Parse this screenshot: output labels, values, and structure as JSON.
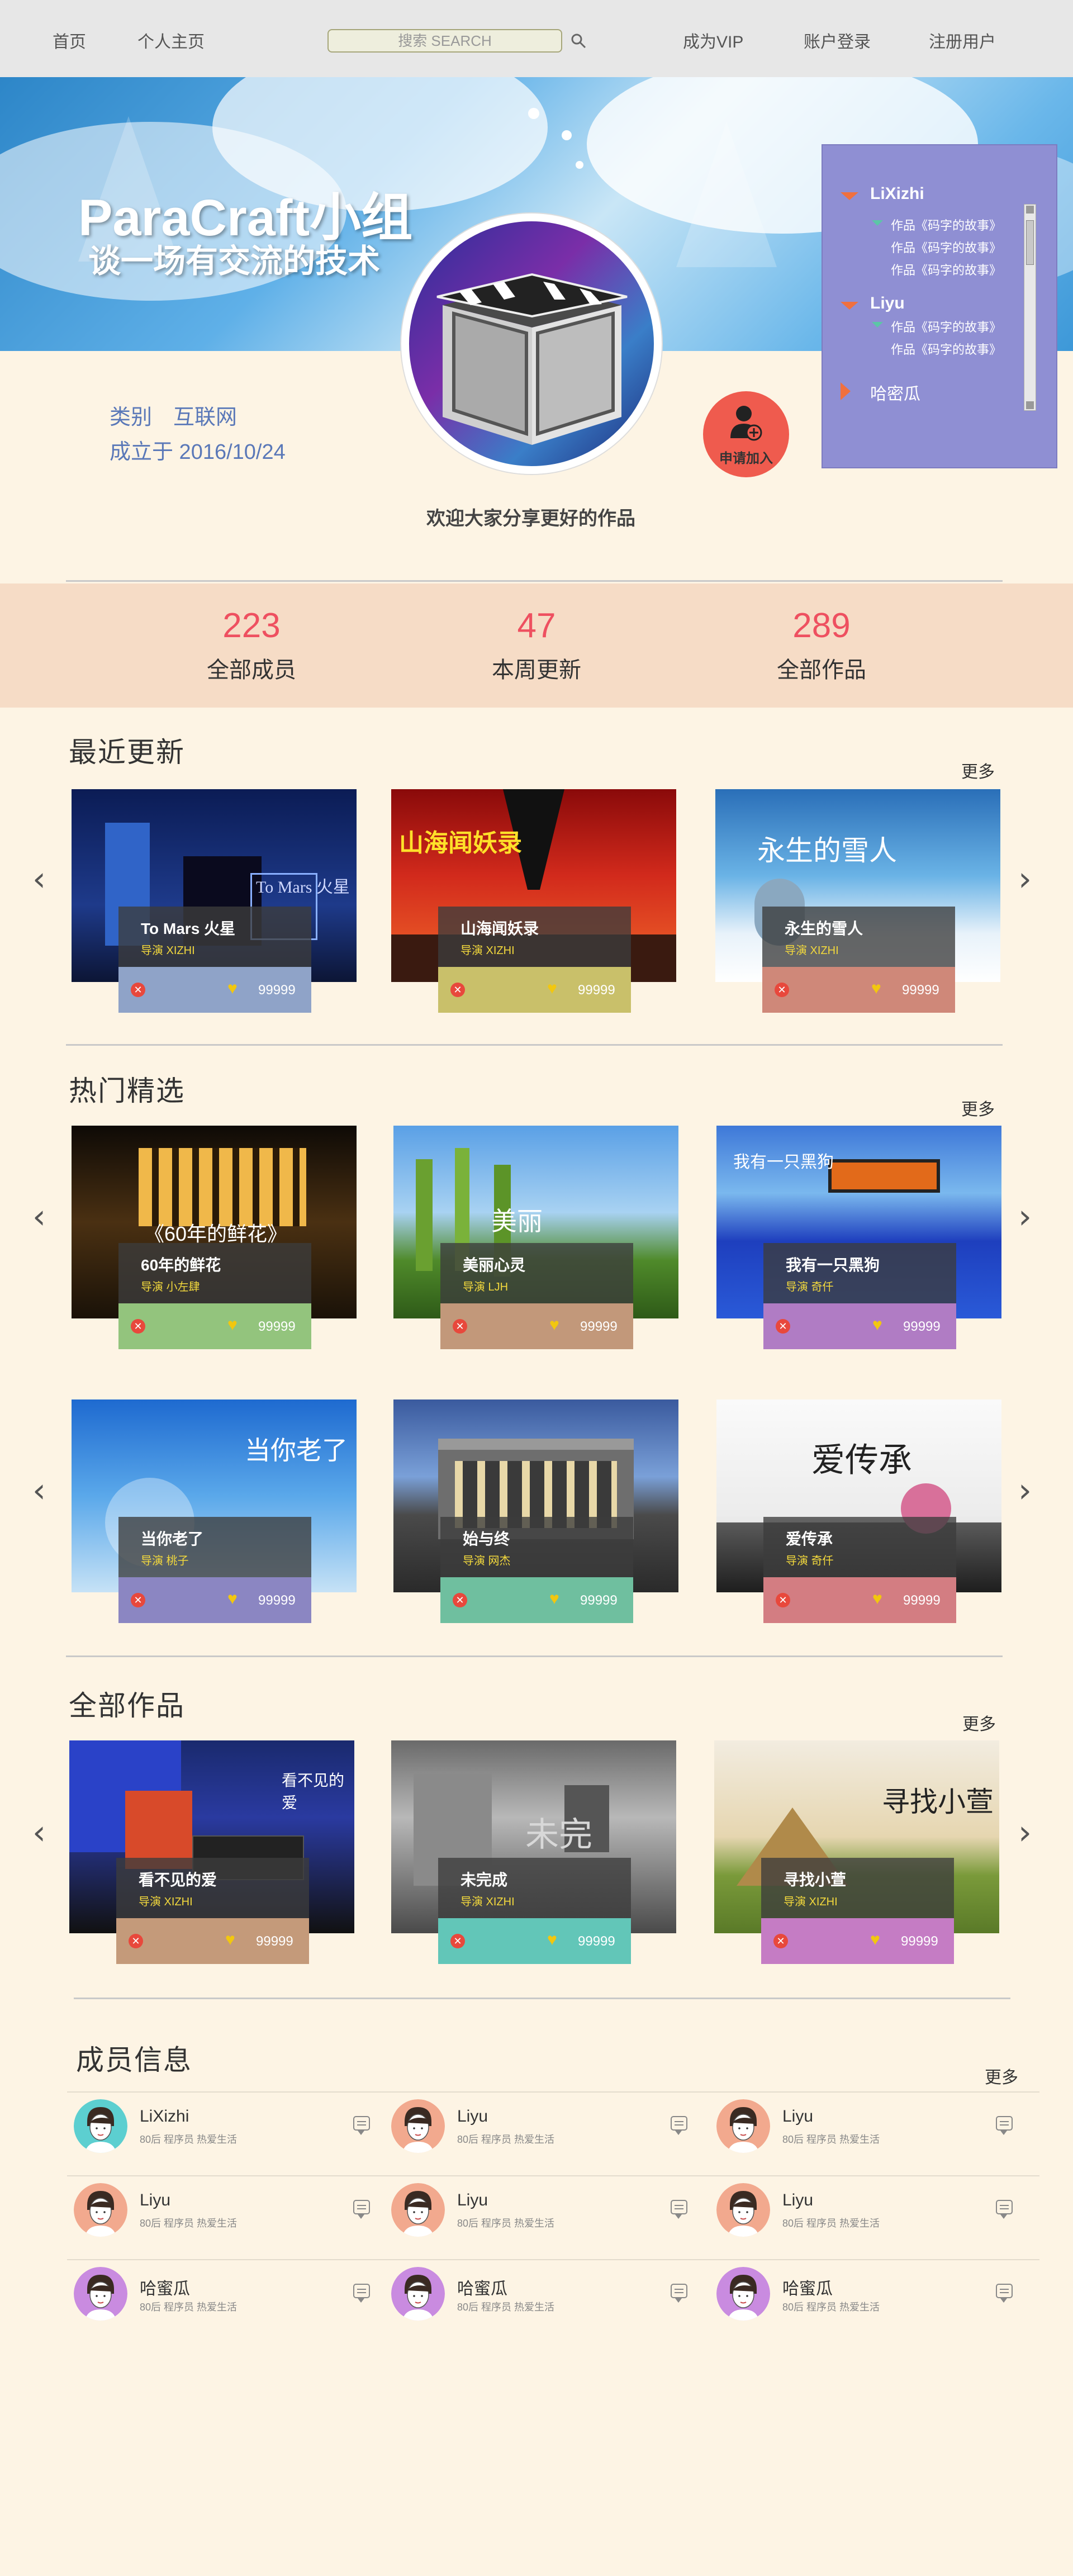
{
  "nav": {
    "home": "首页",
    "profile": "个人主页",
    "search_placeholder": "搜索 SEARCH",
    "vip": "成为VIP",
    "login": "账户登录",
    "register": "注册用户"
  },
  "hero": {
    "title": "ParaCraft小组",
    "subtitle": "谈一场有交流的技术",
    "category": "类别　互联网",
    "founded": "成立于 2016/10/24",
    "join_label": "申请加入",
    "welcome": "欢迎大家分享更好的作品"
  },
  "tree": {
    "users": [
      {
        "name": "LiXizhi",
        "works": [
          "作品《码字的故事》",
          "作品《码字的故事》",
          "作品《码字的故事》"
        ]
      },
      {
        "name": "Liyu",
        "works": [
          "作品《码字的故事》",
          "作品《码字的故事》"
        ]
      },
      {
        "name": "哈密瓜",
        "works": []
      }
    ]
  },
  "stats": [
    {
      "value": "223",
      "label": "全部成员"
    },
    {
      "value": "47",
      "label": "本周更新"
    },
    {
      "value": "289",
      "label": "全部作品"
    }
  ],
  "sections": {
    "recent": "最近更新",
    "hot": "热门精选",
    "all": "全部作品",
    "members": "成员信息",
    "more": "更多"
  },
  "recent_cards": [
    {
      "title": "To Mars 火星",
      "director": "导演 XIZHI",
      "likes": "99999",
      "bar_color": "#8fa3c8"
    },
    {
      "title": "山海闻妖录",
      "director": "导演 XIZHI",
      "likes": "99999",
      "bar_color": "#c9c06a"
    },
    {
      "title": "永生的雪人",
      "director": "导演 XIZHI",
      "likes": "99999",
      "bar_color": "#cf8879"
    }
  ],
  "hot_cards": [
    {
      "title": "60年的鲜花",
      "director": "导演 小左肆",
      "likes": "99999",
      "bar_color": "#93c47d"
    },
    {
      "title": "美丽心灵",
      "director": "导演 LJH",
      "likes": "99999",
      "bar_color": "#c2987a"
    },
    {
      "title": "我有一只黑狗",
      "director": "导演 奇仟",
      "likes": "99999",
      "bar_color": "#b07cc4"
    },
    {
      "title": "当你老了",
      "director": "导演 桃子",
      "likes": "99999",
      "bar_color": "#8b86c2"
    },
    {
      "title": "始与终",
      "director": "导演 网杰",
      "likes": "99999",
      "bar_color": "#6fbf9f"
    },
    {
      "title": "爱传承",
      "director": "导演 奇仟",
      "likes": "99999",
      "bar_color": "#d37d82"
    }
  ],
  "all_cards": [
    {
      "title": "看不见的爱",
      "director": "导演 XIZHI",
      "likes": "99999",
      "bar_color": "#c49a7a"
    },
    {
      "title": "未完成",
      "director": "导演 XIZHI",
      "likes": "99999",
      "bar_color": "#62c6b8"
    },
    {
      "title": "寻找小萱",
      "director": "导演 XIZHI",
      "likes": "99999",
      "bar_color": "#c57cc4"
    }
  ],
  "card_art": {
    "recent_0": "To Mars 火星",
    "recent_1": "山海闻妖录",
    "recent_2": "永生的雪人",
    "hot_0": "《60年的鲜花》",
    "hot_1": "美丽",
    "hot_2": "我有一只黑狗",
    "hot_3": "当你老了",
    "hot_5": "爱传承",
    "all_0": "看不见的爱",
    "all_1": "未完",
    "all_2": "寻找小萱"
  },
  "members": [
    {
      "name": "LiXizhi",
      "desc": "80后 程序员 热爱生活",
      "avatar_color": "#5ccfd0"
    },
    {
      "name": "Liyu",
      "desc": "80后 程序员 热爱生活",
      "avatar_color": "#f2a98e"
    },
    {
      "name": "Liyu",
      "desc": "80后 程序员 热爱生活",
      "avatar_color": "#f2a98e"
    },
    {
      "name": "Liyu",
      "desc": "80后 程序员 热爱生活",
      "avatar_color": "#f2a98e"
    },
    {
      "name": "Liyu",
      "desc": "80后 程序员 热爱生活",
      "avatar_color": "#f2a98e"
    },
    {
      "name": "Liyu",
      "desc": "80后 程序员 热爱生活",
      "avatar_color": "#f2a98e"
    },
    {
      "name": "哈蜜瓜",
      "desc": "80后 程序员 热爱生活",
      "avatar_color": "#c98be0"
    },
    {
      "name": "哈蜜瓜",
      "desc": "80后 程序员 热爱生活",
      "avatar_color": "#c98be0"
    },
    {
      "name": "哈蜜瓜",
      "desc": "80后 程序员 热爱生活",
      "avatar_color": "#c98be0"
    }
  ]
}
